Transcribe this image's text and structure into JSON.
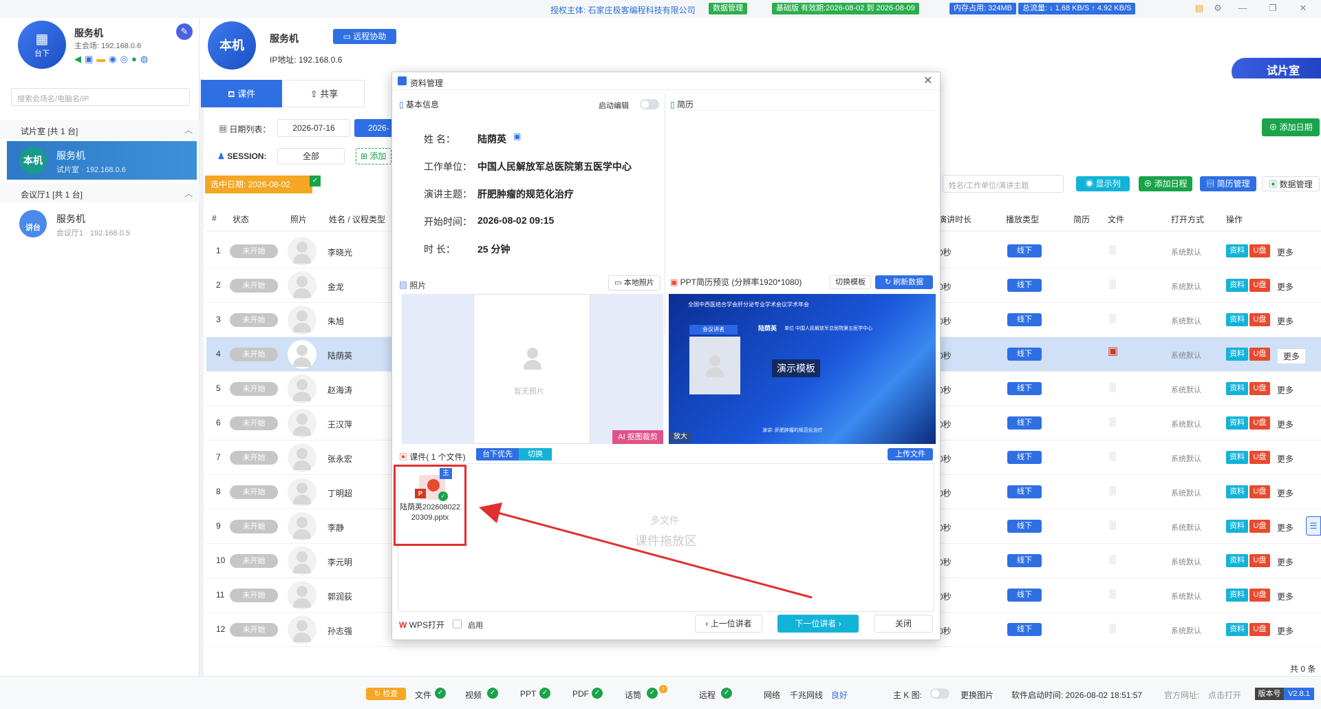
{
  "topbar": {
    "auth": "授权主体: 石家庄极客编程科技有限公司",
    "data_mgmt": "数据管理",
    "edition": "基础版 有效期:2026-08-02 到 2026-08-09",
    "mem": "内存占用: 324MB",
    "flow": "总流量: ↓ 1.68 KB/S  ↑ 4.92 KB/S"
  },
  "sidebar": {
    "logo_label": "台下",
    "server_title": "服务机",
    "server_addr": "主会场: 192.168.0.6",
    "search_placeholder": "搜索会场名/电脑名/IP",
    "group1": "试片室   [共 1 台]",
    "dev1_avatar": "本机",
    "dev1_name": "服务机",
    "dev1_sub": "试片室 · 192.168.0.6",
    "group2": "会议厅1   [共 1 台]",
    "dev2_avatar": "讲台",
    "dev2_name": "服务机",
    "dev2_sub": "会议厅1 · 192.168.0.5"
  },
  "header": {
    "node": "本机",
    "name": "服务机",
    "remote": "远程协助",
    "ip": "IP地址: 192.168.0.6",
    "trial": "试片室"
  },
  "tabs": {
    "course": "课件",
    "share": "共享"
  },
  "filter": {
    "date_label": "日期列表：",
    "date1": "2026-07-16",
    "date2": "2026-",
    "session_label": "SESSION:",
    "session_value": "全部",
    "add_label": "添加",
    "selected_date": "选中日期: 2026-08-02",
    "add_date": "添加日期",
    "search_placeholder": "姓名/工作单位/演讲主题",
    "show_cols": "显示列",
    "add_schedule": "添加日程",
    "resume_mgmt": "简历管理",
    "data_mgmt": "数据管理"
  },
  "table": {
    "headers": [
      "#",
      "状态",
      "照片",
      "姓名 / 议程类型",
      "演讲时长",
      "播放类型",
      "简历",
      "文件",
      "打开方式",
      "操作"
    ],
    "rows": [
      {
        "n": "1",
        "status": "未开始",
        "name": "李晓光",
        "dur": "0秒",
        "play": "线下",
        "open": "系统默认"
      },
      {
        "n": "2",
        "status": "未开始",
        "name": "金龙",
        "dur": "0秒",
        "play": "线下",
        "open": "系统默认"
      },
      {
        "n": "3",
        "status": "未开始",
        "name": "朱旭",
        "dur": "0秒",
        "play": "线下",
        "open": "系统默认"
      },
      {
        "n": "4",
        "status": "未开始",
        "name": "陆荫英",
        "dur": "0秒",
        "play": "线下",
        "open": "系统默认"
      },
      {
        "n": "5",
        "status": "未开始",
        "name": "赵海涛",
        "dur": "0秒",
        "play": "线下",
        "open": "系统默认"
      },
      {
        "n": "6",
        "status": "未开始",
        "name": "王汉萍",
        "dur": "0秒",
        "play": "线下",
        "open": "系统默认"
      },
      {
        "n": "7",
        "status": "未开始",
        "name": "张永宏",
        "dur": "0秒",
        "play": "线下",
        "open": "系统默认"
      },
      {
        "n": "8",
        "status": "未开始",
        "name": "丁明超",
        "dur": "0秒",
        "play": "线下",
        "open": "系统默认"
      },
      {
        "n": "9",
        "status": "未开始",
        "name": "李静",
        "dur": "0秒",
        "play": "线下",
        "open": "系统默认"
      },
      {
        "n": "10",
        "status": "未开始",
        "name": "李元明",
        "dur": "0秒",
        "play": "线下",
        "open": "系统默认"
      },
      {
        "n": "11",
        "status": "未开始",
        "name": "郭润荻",
        "dur": "0秒",
        "play": "线下",
        "open": "系统默认"
      },
      {
        "n": "12",
        "status": "未开始",
        "name": "孙志强",
        "dur": "0秒",
        "play": "线下",
        "open": "系统默认"
      }
    ],
    "op_data": "资料",
    "op_usb": "U盘",
    "op_more": "更多",
    "total": "共 0 条"
  },
  "modal": {
    "title": "资料管理",
    "basic": "基本信息",
    "edit_toggle": "启动编辑",
    "resume": "简历",
    "name_label": "姓     名：",
    "name": "陆荫英",
    "org_label": "工作单位：",
    "org": "中国人民解放军总医院第五医学中心",
    "topic_label": "演讲主题：",
    "topic": "肝肥肿瘤的规范化治疗",
    "start_label": "开始时间：",
    "start": "2026-08-02 09:15",
    "dur_label": "时     长：",
    "dur": "25 分钟",
    "photo": "照片",
    "local_photo": "本地照片",
    "no_photo": "暂无照片",
    "ai_crop": "AI 抠图裁剪",
    "ppt_preview": "PPT简历预览 (分辨率1920*1080)",
    "switch_tpl": "切换模板",
    "refresh": "刷新数据",
    "slide_header": "全国中西医结合学会肝分泌专业学术会议学术年会",
    "slide_speaker_tag": "会议讲者",
    "slide_name": "陆荫英",
    "slide_org": "单位  中国人民解放军总医院第五医学中心",
    "slide_tpl": "演示模板",
    "slide_topic": "演讲: 肝肥肿瘤的规范化治疗",
    "zoom": "放大",
    "course_files": "课件( 1 个文件)",
    "priority": "台下优先",
    "switch": "切换",
    "upload": "上传文件",
    "file_badge": "主",
    "file_name": "陆荫英20260802220309.pptx",
    "drop1": "多文件",
    "drop2": "课件拖放区",
    "wps": "WPS打开",
    "enable": "启用",
    "prev": "上一位讲者",
    "next": "下一位讲者",
    "close": "关闭"
  },
  "statusbar": {
    "check": "检查",
    "file": "文件",
    "video": "视频",
    "ppt": "PPT",
    "pdf": "PDF",
    "talk": "话筒",
    "remote": "远程",
    "net": "网络",
    "gig": "千兆网线",
    "good": "良好",
    "kmain": "主 K 图:",
    "change_img": "更换图片",
    "start_time": "软件启动时间: 2026-08-02 18:51:57",
    "site": "官方网址:",
    "open": "点击打开",
    "ver_label": "版本号",
    "ver": "V2.8.1"
  }
}
